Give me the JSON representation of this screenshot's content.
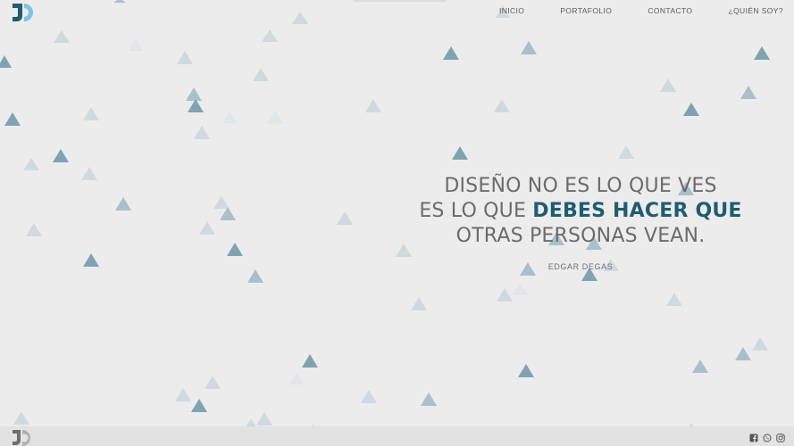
{
  "nav": {
    "items": [
      {
        "label": "INICIO"
      },
      {
        "label": "PORTAFOLIO"
      },
      {
        "label": "CONTACTO"
      },
      {
        "label": "¿QUIÉN SOY?"
      }
    ]
  },
  "hero": {
    "line1": "DISEÑO NO ES LO QUE VES",
    "line2_start": "ES LO QUE ",
    "line2_accent": "DEBES HACER QUE",
    "line3": "OTRAS PERSONAS VEAN.",
    "author": "EDGAR DEGAS"
  },
  "footer": {
    "social": [
      "facebook-icon",
      "whatsapp-icon",
      "instagram-icon"
    ]
  },
  "colors": {
    "background": "#ececec",
    "accent": "#1f5c72",
    "text": "#6b6b6b",
    "logo_dark": "#1f5c72",
    "logo_light": "#7ec3e6",
    "triangle_dark": "#7fa3b0",
    "triangle_light": "#cfdadf",
    "footer_bar": "#e2e2e2"
  }
}
